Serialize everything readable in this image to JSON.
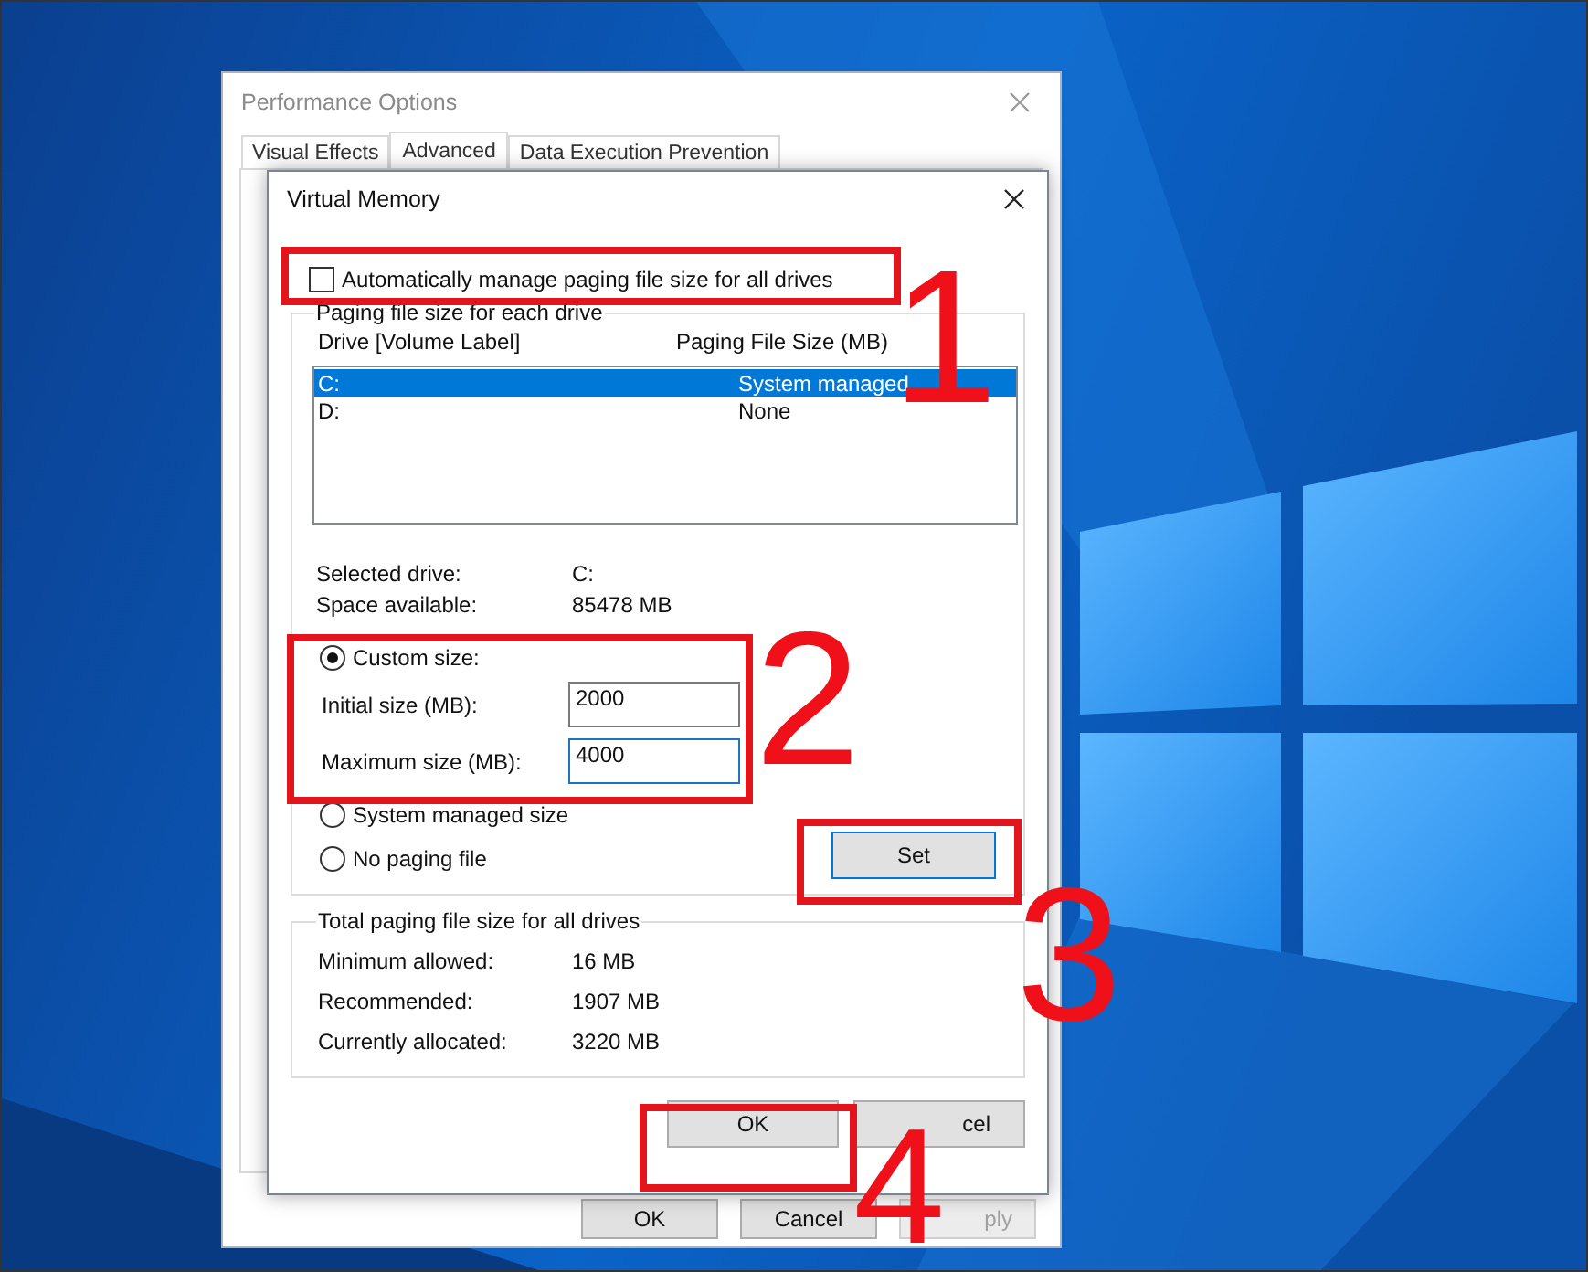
{
  "performance_options": {
    "title": "Performance Options",
    "tabs": [
      {
        "label": "Visual Effects",
        "selected": false
      },
      {
        "label": "Advanced",
        "selected": true
      },
      {
        "label": "Data Execution Prevention",
        "selected": false
      }
    ],
    "buttons": [
      {
        "label": "OK",
        "disabled": false
      },
      {
        "label": "Cancel",
        "disabled": false
      },
      {
        "label": "ply",
        "disabled": true
      }
    ]
  },
  "virtual_memory": {
    "title": "Virtual Memory",
    "auto_manage": {
      "label": "Automatically manage paging file size for all drives",
      "checked": false
    },
    "paging_group": {
      "title": "Paging file size for each drive",
      "columns": [
        "Drive  [Volume Label]",
        "Paging File Size (MB)"
      ],
      "drives": [
        {
          "drive": "C:",
          "size": "System managed",
          "selected": true
        },
        {
          "drive": "D:",
          "size": "None",
          "selected": false
        }
      ],
      "details": [
        {
          "label": "Selected drive:",
          "value": "C:"
        },
        {
          "label": "Space available:",
          "value": "85478 MB"
        }
      ],
      "options": [
        {
          "label": "Custom size:",
          "selected": true
        },
        {
          "label": "System managed size",
          "selected": false
        },
        {
          "label": "No paging file",
          "selected": false
        }
      ],
      "fields": [
        {
          "label": "Initial size (MB):",
          "value": "2000",
          "focused": false
        },
        {
          "label": "Maximum size (MB):",
          "value": "4000",
          "focused": true
        }
      ],
      "set_button": "Set"
    },
    "totals": {
      "title": "Total paging file size for all drives",
      "rows": [
        {
          "label": "Minimum allowed:",
          "value": "16 MB"
        },
        {
          "label": "Recommended:",
          "value": "1907 MB"
        },
        {
          "label": "Currently allocated:",
          "value": "3220 MB"
        }
      ]
    },
    "buttons": [
      "OK",
      "cel"
    ]
  },
  "annotations": [
    {
      "label": "1"
    },
    {
      "label": "2"
    },
    {
      "label": "3"
    },
    {
      "label": "4"
    }
  ]
}
